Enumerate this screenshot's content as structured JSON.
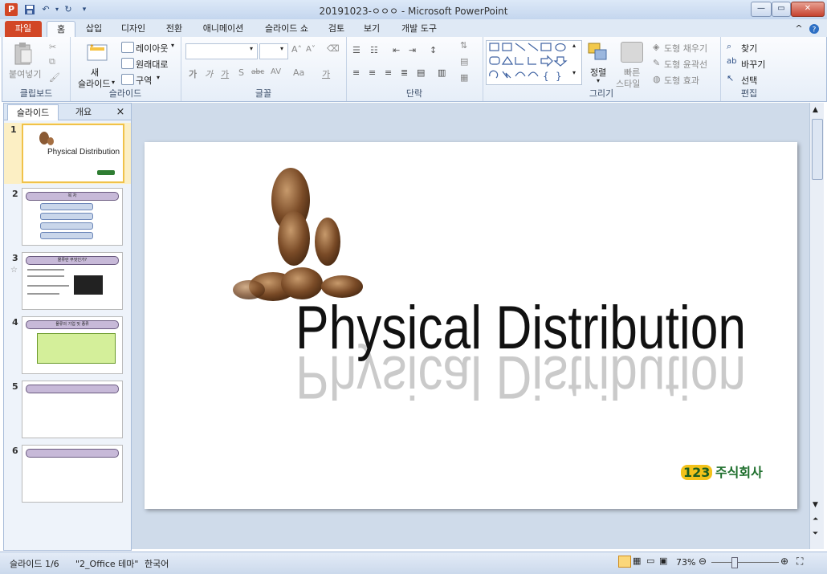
{
  "window": {
    "title": "20191023-ㅇㅇㅇ - Microsoft PowerPoint"
  },
  "tabs": [
    {
      "label": "파일"
    },
    {
      "label": "홈"
    },
    {
      "label": "삽입"
    },
    {
      "label": "디자인"
    },
    {
      "label": "전환"
    },
    {
      "label": "애니메이션"
    },
    {
      "label": "슬라이드 쇼"
    },
    {
      "label": "검토"
    },
    {
      "label": "보기"
    },
    {
      "label": "개발 도구"
    }
  ],
  "ribbon": {
    "clipboard": {
      "label": "클립보드",
      "paste": "붙여넣기"
    },
    "slides": {
      "label": "슬라이드",
      "new_slide_line1": "새",
      "new_slide_line2": "슬라이드",
      "layout": "레이아웃",
      "reset": "원래대로",
      "section": "구역"
    },
    "font": {
      "label": "글꼴",
      "chars": [
        "가",
        "가",
        "가",
        "S",
        "abc",
        "AV",
        "Aa",
        "가"
      ]
    },
    "paragraph": {
      "label": "단락"
    },
    "drawing": {
      "label": "그리기",
      "arrange": "정렬",
      "quick_style_line1": "빠른",
      "quick_style_line2": "스타일",
      "shape_fill": "도형 채우기",
      "shape_outline": "도형 윤곽선",
      "shape_effects": "도형 효과"
    },
    "editing": {
      "label": "편집",
      "find": "찾기",
      "replace": "바꾸기",
      "select": "선택"
    }
  },
  "pane": {
    "tab_slides": "슬라이드",
    "tab_outline": "개요",
    "close": "×"
  },
  "thumbnails": [
    {
      "num": "1",
      "title": "Physical Distribution"
    },
    {
      "num": "2",
      "title": "목 차"
    },
    {
      "num": "3",
      "title": "물류란 무엇인가?"
    },
    {
      "num": "4",
      "title": "물류의 기업 및 종류"
    },
    {
      "num": "5",
      "title": ""
    },
    {
      "num": "6",
      "title": ""
    }
  ],
  "slide": {
    "title": "Physical Distribution",
    "logo_num": "123",
    "logo_text": "주식회사"
  },
  "status": {
    "slide_info": "슬라이드 1/6",
    "theme": "\"2_Office 테마\"",
    "language": "한국어",
    "zoom": "73%"
  },
  "colors": {
    "accent_file_tab": "#d24726",
    "thumb_bar": "#c7b9d8",
    "selected_thumb": "#f0c24a"
  }
}
